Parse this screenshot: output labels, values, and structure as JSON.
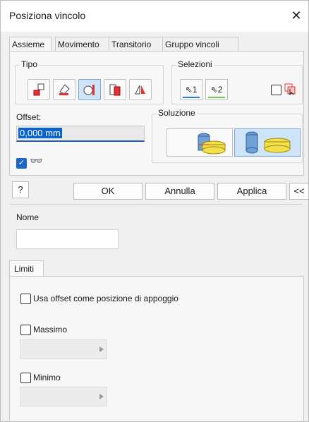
{
  "window": {
    "title": "Posiziona vincolo",
    "close_glyph": "✕"
  },
  "tabs": [
    "Assieme",
    "Movimento",
    "Transitorio",
    "Gruppo vincoli"
  ],
  "tipo": {
    "label": "Tipo",
    "buttons": [
      "mate-icon",
      "angle-icon",
      "tangent-icon",
      "insert-icon",
      "symmetry-icon"
    ],
    "selected_index": 2
  },
  "selezioni": {
    "label": "Selezioni",
    "sel1": "1",
    "sel2": "2",
    "sel1_color": "#2a7be4",
    "sel2_color": "#7bbf58"
  },
  "offset": {
    "label": "Offset:",
    "value": "0,000 mm"
  },
  "soluzione": {
    "label": "Soluzione",
    "selected_index": 1
  },
  "preview_checked": true,
  "buttons": {
    "help": "?",
    "ok": "OK",
    "cancel": "Annulla",
    "apply": "Applica",
    "more": "<<"
  },
  "nome": {
    "label": "Nome",
    "value": ""
  },
  "limiti": {
    "tab": "Limiti",
    "use_offset_label": "Usa offset come posizione di appoggio",
    "max_label": "Massimo",
    "min_label": "Minimo"
  }
}
